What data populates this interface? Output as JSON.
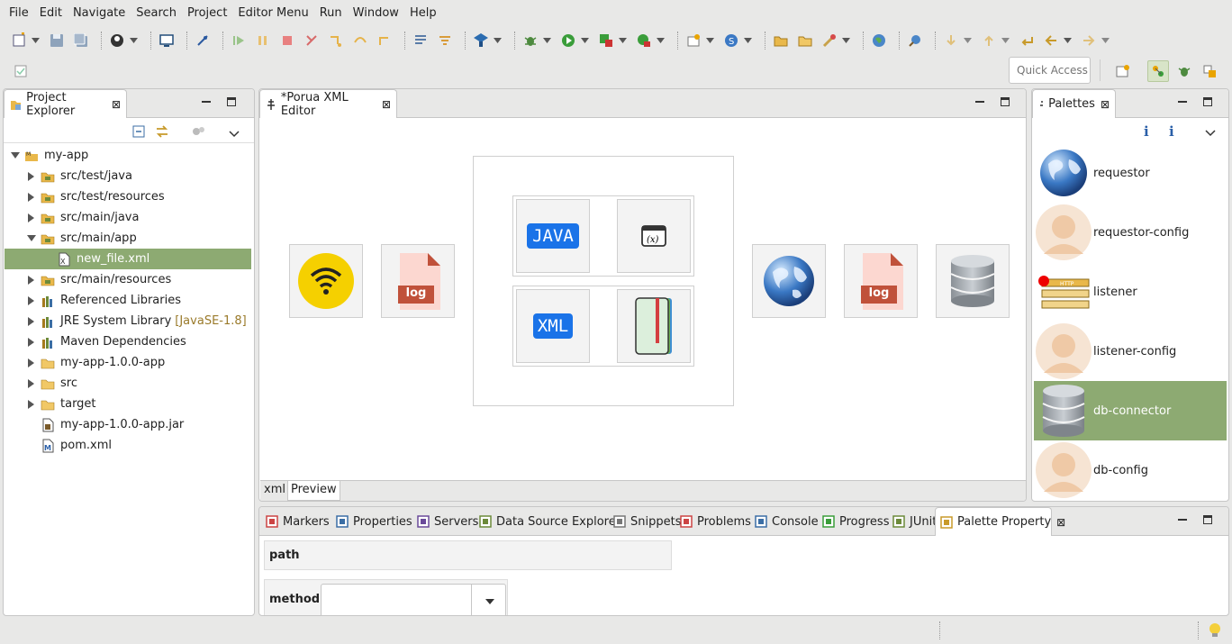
{
  "menu": [
    "File",
    "Edit",
    "Navigate",
    "Search",
    "Project",
    "Editor Menu",
    "Run",
    "Window",
    "Help"
  ],
  "toolbar": {
    "quick_access_placeholder": "Quick Access"
  },
  "project_explorer": {
    "tab_label": "Project Explorer",
    "tree": [
      {
        "label": "my-app",
        "icon": "project-icon",
        "arrow": "expanded",
        "indent": 0
      },
      {
        "label": "src/test/java",
        "icon": "source-folder-icon",
        "arrow": "collapsed",
        "indent": 1
      },
      {
        "label": "src/test/resources",
        "icon": "source-folder-icon",
        "arrow": "collapsed",
        "indent": 1
      },
      {
        "label": "src/main/java",
        "icon": "source-folder-icon",
        "arrow": "collapsed",
        "indent": 1
      },
      {
        "label": "src/main/app",
        "icon": "source-folder-icon",
        "arrow": "expanded",
        "indent": 1
      },
      {
        "label": "new_file.xml",
        "icon": "xml-file-icon",
        "arrow": "none",
        "indent": 2,
        "selected": true
      },
      {
        "label": "src/main/resources",
        "icon": "source-folder-icon",
        "arrow": "collapsed",
        "indent": 1
      },
      {
        "label": "Referenced Libraries",
        "icon": "library-icon",
        "arrow": "collapsed",
        "indent": 1
      },
      {
        "label": "JRE System Library",
        "suffix": "[JavaSE-1.8]",
        "icon": "library-icon",
        "arrow": "collapsed",
        "indent": 1
      },
      {
        "label": "Maven Dependencies",
        "icon": "library-icon",
        "arrow": "collapsed",
        "indent": 1
      },
      {
        "label": "my-app-1.0.0-app",
        "icon": "folder-icon",
        "arrow": "collapsed",
        "indent": 1
      },
      {
        "label": "src",
        "icon": "folder-icon",
        "arrow": "collapsed",
        "indent": 1
      },
      {
        "label": "target",
        "icon": "folder-icon",
        "arrow": "collapsed",
        "indent": 1
      },
      {
        "label": "my-app-1.0.0-app.jar",
        "icon": "jar-icon",
        "arrow": "none",
        "indent": 1
      },
      {
        "label": "pom.xml",
        "icon": "maven-pom-icon",
        "arrow": "none",
        "indent": 1
      }
    ]
  },
  "editor": {
    "tab_label": "*Porua XML Editor",
    "canvas": {
      "java_label": "JAVA",
      "xml_label": "XML",
      "log_label": "log",
      "log2_label": "log"
    },
    "bottom_tabs": [
      "xml",
      "Preview"
    ]
  },
  "palettes": {
    "tab_label": "Palettes",
    "items": [
      {
        "label": "requestor",
        "icon": "globe-icon"
      },
      {
        "label": "requestor-config",
        "icon": "user-avatar-icon"
      },
      {
        "label": "listener",
        "icon": "http-listener-icon"
      },
      {
        "label": "listener-config",
        "icon": "user-avatar-icon"
      },
      {
        "label": "db-connector",
        "icon": "database-icon",
        "selected": true
      },
      {
        "label": "db-config",
        "icon": "user-avatar-icon"
      }
    ]
  },
  "bottom_panel": {
    "tabs": [
      {
        "label": "Markers",
        "icon": "markers-icon"
      },
      {
        "label": "Properties",
        "icon": "properties-icon"
      },
      {
        "label": "Servers",
        "icon": "servers-icon"
      },
      {
        "label": "Data Source Explorer",
        "icon": "data-source-icon"
      },
      {
        "label": "Snippets",
        "icon": "snippets-icon"
      },
      {
        "label": "Problems",
        "icon": "problems-icon"
      },
      {
        "label": "Console",
        "icon": "console-icon"
      },
      {
        "label": "Progress",
        "icon": "progress-icon"
      },
      {
        "label": "JUnit",
        "icon": "junit-icon"
      },
      {
        "label": "Palette Property",
        "icon": "palette-property-icon",
        "active": true
      }
    ],
    "path_label": "path",
    "method_label": "method",
    "method_value": ""
  },
  "colors": {
    "selection": "#8daa72",
    "java_badge": "#1a73e8",
    "log_badge": "#c0513a",
    "wifi_yellow": "#f5d000"
  }
}
